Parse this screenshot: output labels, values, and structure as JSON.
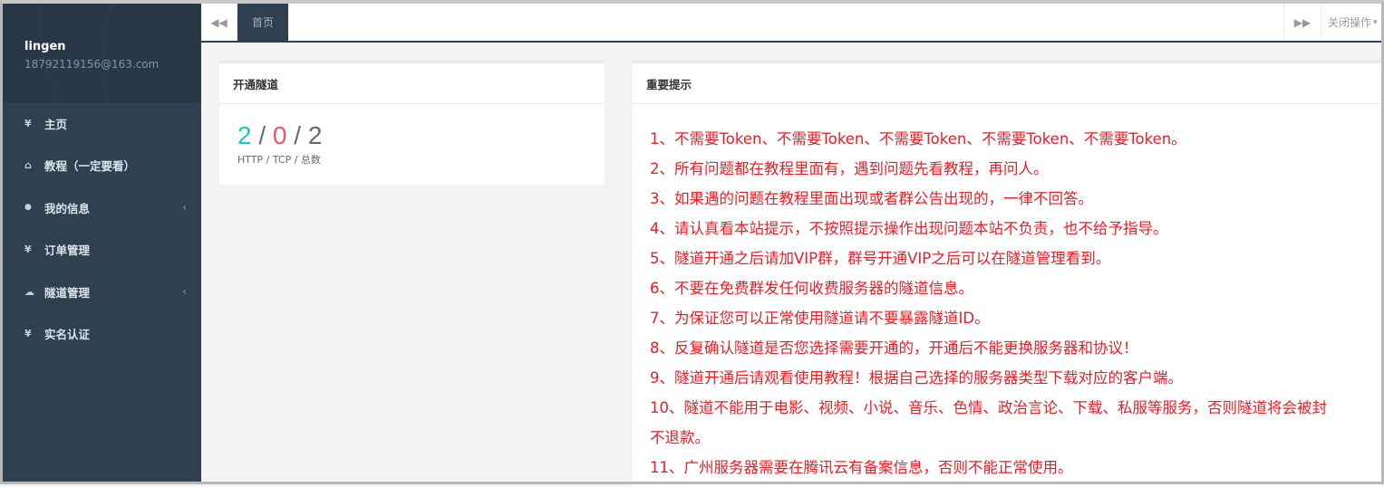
{
  "user": {
    "name": "lingen",
    "email": "18792119156@163.com"
  },
  "nav": [
    {
      "icon": "yen-icon",
      "glyph": "¥",
      "label": "主页",
      "has_arrow": false
    },
    {
      "icon": "home-icon",
      "glyph": "⌂",
      "label": "教程（一定要看）",
      "has_arrow": false
    },
    {
      "icon": "user-icon",
      "glyph": "●",
      "label": "我的信息",
      "has_arrow": true
    },
    {
      "icon": "yen-icon",
      "glyph": "¥",
      "label": "订单管理",
      "has_arrow": false
    },
    {
      "icon": "cloud-icon",
      "glyph": "☁",
      "label": "隧道管理",
      "has_arrow": true
    },
    {
      "icon": "yen-icon",
      "glyph": "¥",
      "label": "实名认证",
      "has_arrow": false
    }
  ],
  "topbar": {
    "tab_label": "首页",
    "close_label": "关闭操作",
    "left_icon": "double-chevron-left-icon",
    "right_icon": "double-chevron-right-icon"
  },
  "tunnel_panel": {
    "title": "开通隧道",
    "http": "2",
    "tcp": "0",
    "total": "2",
    "sep": "/",
    "caption": "HTTP / TCP / 总数"
  },
  "notice_panel": {
    "title": "重要提示",
    "items": [
      "1、不需要Token、不需要Token、不需要Token、不需要Token、不需要Token。",
      "2、所有问题都在教程里面有，遇到问题先看教程，再问人。",
      "3、如果遇的问题在教程里面出现或者群公告出现的，一律不回答。",
      "4、请认真看本站提示，不按照提示操作出现问题本站不负责，也不给予指导。",
      "5、隧道开通之后请加VIP群，群号开通VIP之后可以在隧道管理看到。",
      "6、不要在免费群发任何收费服务器的隧道信息。",
      "7、为保证您可以正常使用隧道请不要暴露隧道ID。",
      "8、反复确认隧道是否您选择需要开通的，开通后不能更换服务器和协议！",
      "9、隧道开通后请观看使用教程！根据自己选择的服务器类型下载对应的客户端。",
      "10、隧道不能用于电影、视频、小说、音乐、色情、政治言论、下载、私服等服务，否则隧道将会被封",
      "不退款。",
      "11、广州服务器需要在腾讯云有备案信息，否则不能正常使用。"
    ]
  },
  "colors": {
    "sidebar": "#2f4050",
    "accent_teal": "#23c6c8",
    "accent_red": "#ed5565",
    "notice_red": "#ed1c24"
  }
}
